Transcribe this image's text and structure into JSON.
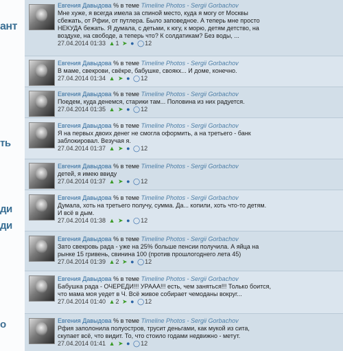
{
  "fragments": [
    "ант",
    "ть",
    "ди",
    "ди",
    "о"
  ],
  "feed": {
    "messages": [
      {
        "author": "Евгения Давыдова",
        "in_topic": "% в теме",
        "topic": "Timeline Photos - Sergii Gorbachov",
        "text": "Мне хуже, я всегда имела за спиной место, куда я могу от Москвы\nсбежать, от Рфии, от путлера. Было заповедное. А теперь мне просто\nНЕКУДА бежать. Я думала, с детьми, к югу, к морю, детям детство, на\nвоздухе, на свободе, а теперь что? К солдатикам? Без воды, ...",
        "timestamp": "27.04.2014 01:33",
        "likes": "1",
        "count": "12"
      },
      {
        "author": "Евгения Давыдова",
        "in_topic": "% в теме",
        "topic": "Timeline Photos - Sergii Gorbachov",
        "text": "В маме, свекрови, свёкре, бабушке, своякх... И доме, конечно.",
        "timestamp": "27.04.2014 01:34",
        "likes": "",
        "count": "12"
      },
      {
        "author": "Евгения Давыдова",
        "in_topic": "% в теме",
        "topic": "Timeline Photos - Sergii Gorbachov",
        "text": "Поедем, куда денемся, старики там... Половина из них радуется.",
        "timestamp": "27.04.2014 01:35",
        "likes": "",
        "count": "12"
      },
      {
        "author": "Евгения Давыдова",
        "in_topic": "% в теме",
        "topic": "Timeline Photos - Sergii Gorbachov",
        "text": "Я на первых двоих денег не смогла оформить, а на третьего - банк\nзаблокировал. Везучая я.",
        "timestamp": "27.04.2014 01:37",
        "likes": "",
        "count": "12"
      },
      {
        "author": "Евгения Давыдова",
        "in_topic": "% в теме",
        "topic": "Timeline Photos - Sergii Gorbachov",
        "text": "детей, я имею ввиду",
        "timestamp": "27.04.2014 01:37",
        "likes": "",
        "count": "12"
      },
      {
        "author": "Евгения Давыдова",
        "in_topic": "% в теме",
        "topic": "Timeline Photos - Sergii Gorbachov",
        "text": "Думала, хоть на третьего получу, сумма. Да... копили, хоть что-то детям.\nИ всё в дым.",
        "timestamp": "27.04.2014 01:38",
        "likes": "",
        "count": "12"
      },
      {
        "author": "Евгения Давыдова",
        "in_topic": "% в теме",
        "topic": "Timeline Photos - Sergii Gorbachov",
        "text": "Зато свекровь рада - уже на 25% больше пенсии получила. А яйца на\nрынке 15 гривень, свинина 100 (против прошлогоднего лета 45)",
        "timestamp": "27.04.2014 01:39",
        "likes": "2",
        "count": "12"
      },
      {
        "author": "Евгения Давыдова",
        "in_topic": "% в теме",
        "topic": "Timeline Photos - Sergii Gorbachov",
        "text": "Бабушка рада - ОЧЕРЕДИ!!! УРААА!!! есть, чем заняться!!! Только боится,\nчто мама моя уедет в Ч. Всё живое собирает чемоданы вокруг...",
        "timestamp": "27.04.2014 01:40",
        "likes": "2",
        "count": "12"
      },
      {
        "author": "Евгения Давыдова",
        "in_topic": "% в теме",
        "topic": "Timeline Photos - Sergii Gorbachov",
        "text": "Рфия заполонила полуостров, трусит деньгами, как мукой из сита,\nскупает всё, что видит. То, что стоило годами недвижно - метут.",
        "timestamp": "27.04.2014 01:41",
        "likes": "",
        "count": "12"
      }
    ]
  }
}
